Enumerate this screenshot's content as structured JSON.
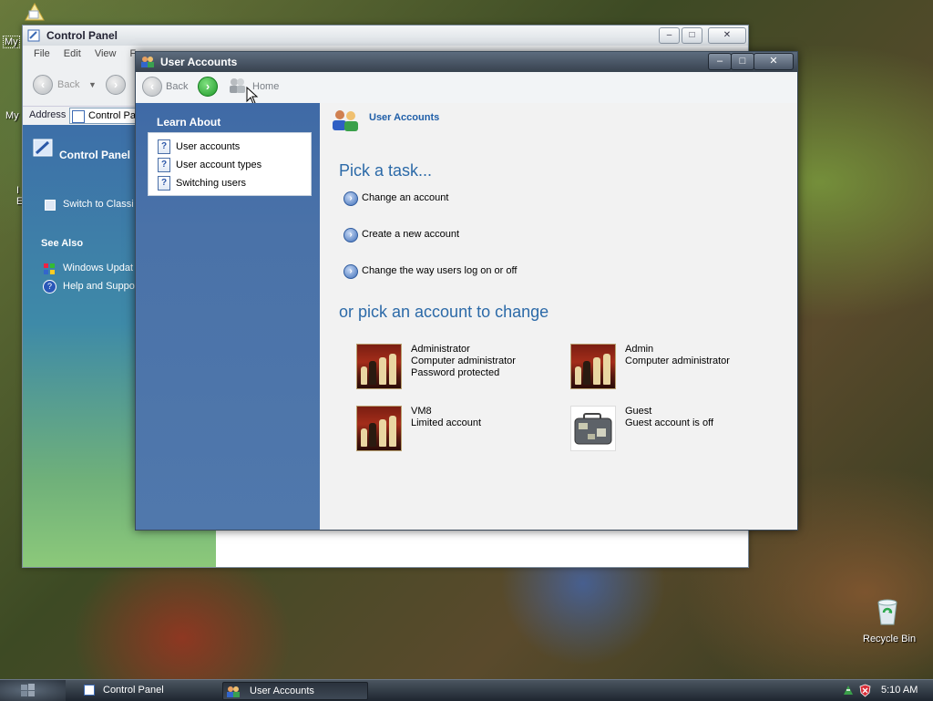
{
  "desktop": {
    "my_documents_label": "My",
    "my_computer_label": "My",
    "recycle_bin_label": "Recycle Bin",
    "partial_labels": [
      "I",
      "E"
    ]
  },
  "control_panel_window": {
    "title": "Control Panel",
    "menu": [
      "File",
      "Edit",
      "View",
      "F"
    ],
    "back_label": "Back",
    "address_label": "Address",
    "address_value": "Control Pa",
    "side_title": "Control Panel",
    "switch_view": "Switch to Classi",
    "see_also_title": "See Also",
    "see_also_items": [
      "Windows Updat",
      "Help and Suppor"
    ],
    "controls": [
      "–",
      "□",
      "✕"
    ]
  },
  "user_accounts_window": {
    "title": "User Accounts",
    "controls": [
      "–",
      "□",
      "✕"
    ],
    "nav": {
      "back_label": "Back",
      "home_label": "Home"
    },
    "learn_about": {
      "title": "Learn About",
      "items": [
        "User accounts",
        "User account types",
        "Switching users"
      ]
    },
    "header": "User Accounts",
    "pick_task_title": "Pick a task...",
    "tasks": [
      "Change an account",
      "Create a new account",
      "Change the way users log on or off"
    ],
    "pick_account_title": "or pick an account to change",
    "accounts": [
      {
        "name": "Administrator",
        "lines": [
          "Computer administrator",
          "Password protected"
        ],
        "picture": "chess-icon"
      },
      {
        "name": "Admin",
        "lines": [
          "Computer administrator",
          ""
        ],
        "picture": "chess-icon"
      },
      {
        "name": "VM8",
        "lines": [
          "Limited account",
          ""
        ],
        "picture": "chess-icon"
      },
      {
        "name": "Guest",
        "lines": [
          "Guest account is off",
          ""
        ],
        "picture": "suitcase-icon"
      }
    ]
  },
  "taskbar": {
    "buttons": [
      "Control Panel",
      "User Accounts"
    ],
    "active_button": "User Accounts",
    "clock": "5:10 AM"
  }
}
